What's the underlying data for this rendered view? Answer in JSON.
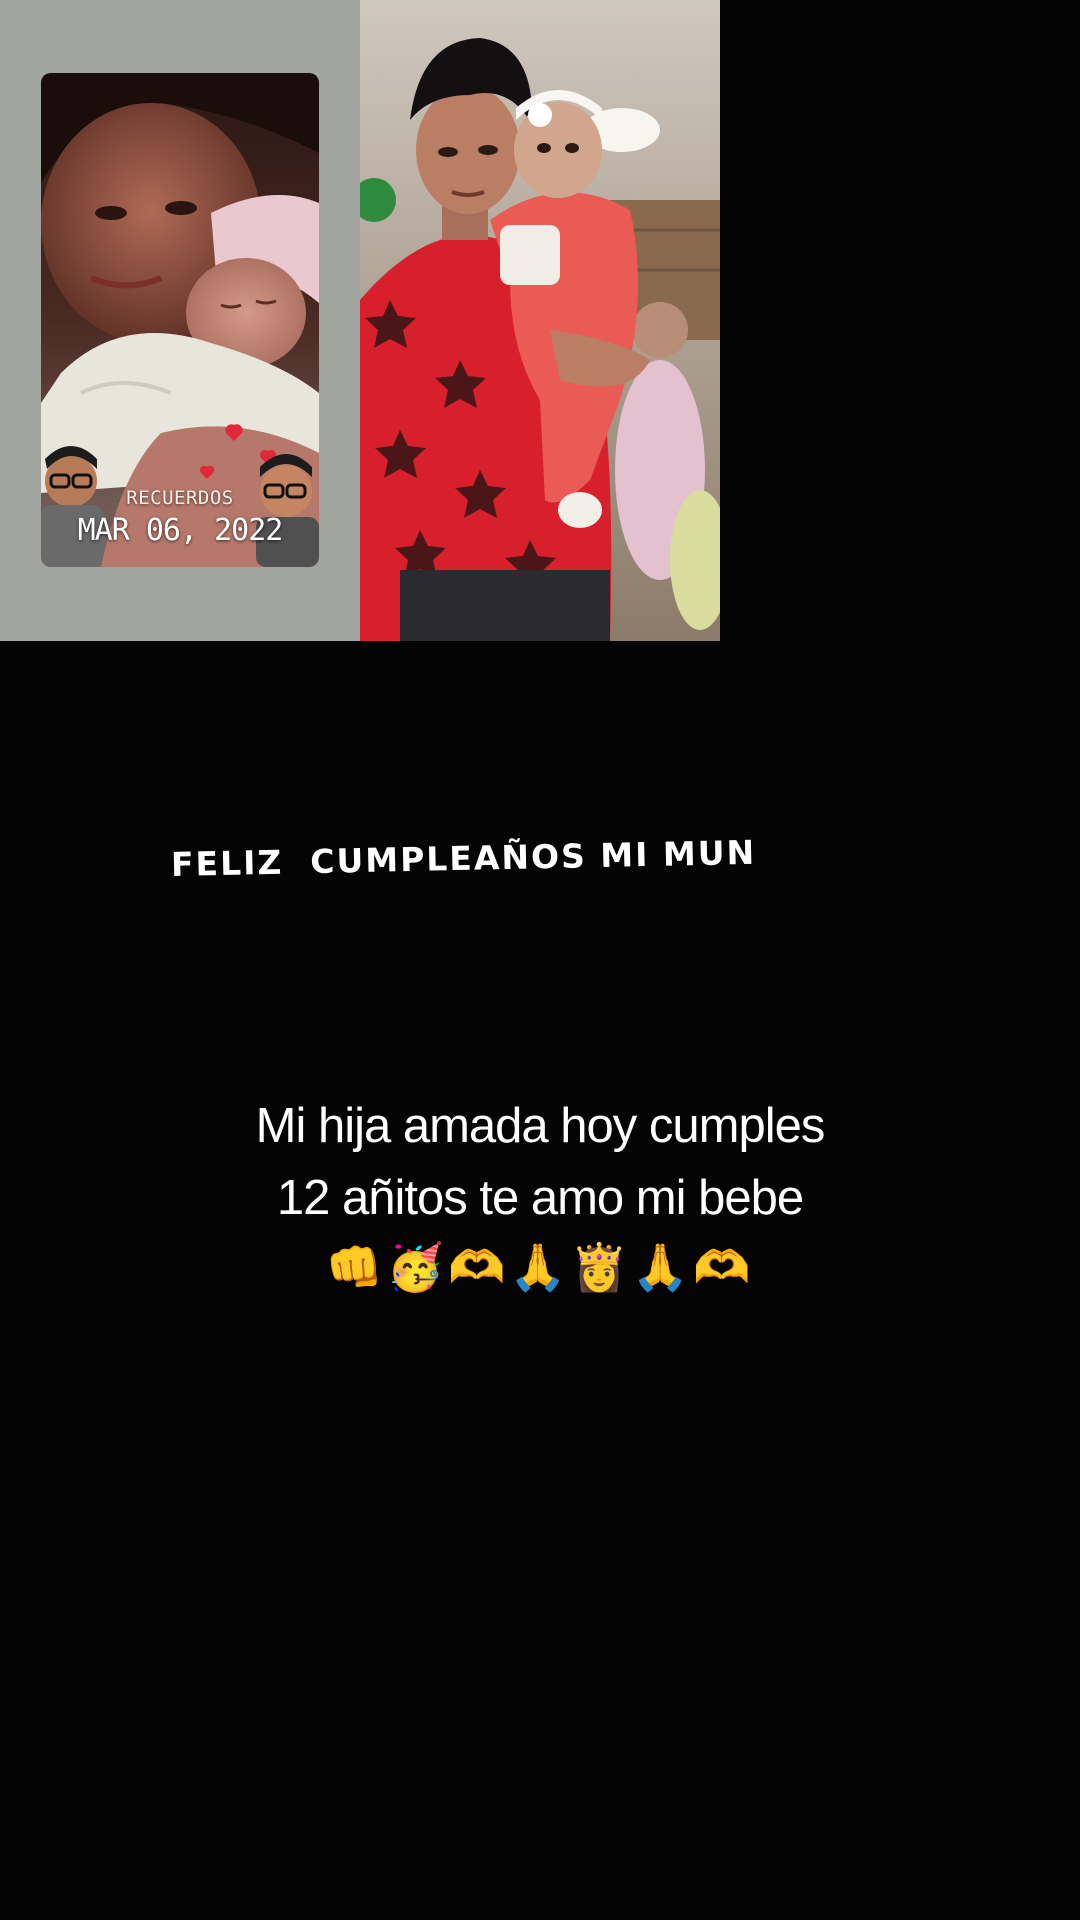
{
  "memory_card": {
    "label": "RECUERDOS",
    "date": "MAR 06, 2022"
  },
  "overlay": {
    "headline": "FELIZ  CUMPLEAÑOS MI MUN"
  },
  "caption": {
    "line1": "Mi hija amada hoy cumples",
    "line2": "12 añitos te amo mi bebe",
    "emojis": "👊🥳🫶🙏👸🙏🫶"
  },
  "colors": {
    "background": "#050405",
    "left_panel": "#a2a59f",
    "text": "#ffffff",
    "shirt_red": "#d8202c"
  }
}
